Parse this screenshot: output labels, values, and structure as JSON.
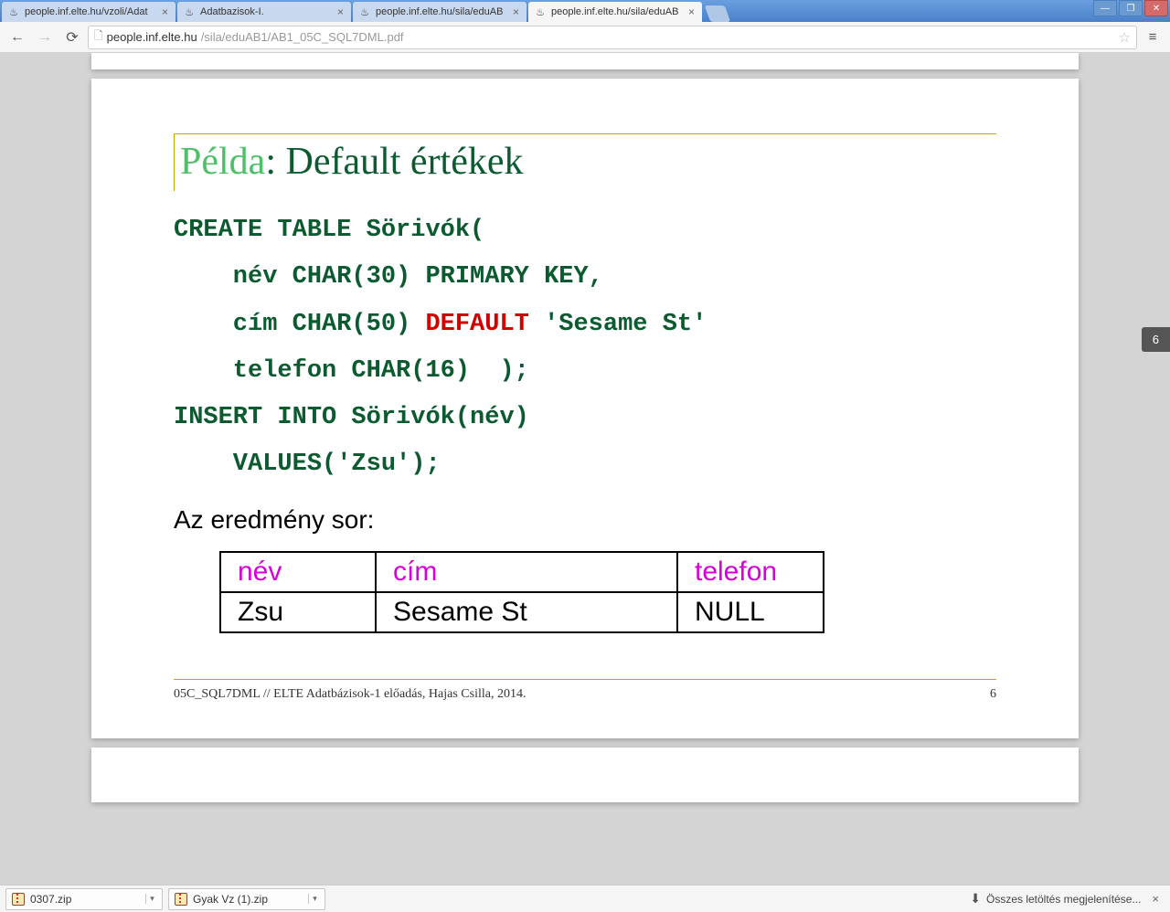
{
  "tabs": [
    {
      "title": "people.inf.elte.hu/vzoli/Adat",
      "active": false
    },
    {
      "title": "Adatbazisok-I.",
      "active": false
    },
    {
      "title": "people.inf.elte.hu/sila/eduAB",
      "active": false
    },
    {
      "title": "people.inf.elte.hu/sila/eduAB",
      "active": true
    }
  ],
  "url": {
    "host": "people.inf.elte.hu",
    "path": "/sila/eduAB1/AB1_05C_SQL7DML.pdf"
  },
  "page_bubble": "6",
  "slide": {
    "title_a": "Példa",
    "title_sep": ": ",
    "title_b": "Default értékek",
    "code": {
      "l1": "CREATE TABLE Sörivók(",
      "l2": "    név CHAR(30) PRIMARY KEY,",
      "l3a": "    cím CHAR(50) ",
      "l3b": "DEFAULT",
      "l3c": " 'Sesame St'",
      "l4": "    telefon CHAR(16)  );",
      "l5": "INSERT INTO Sörivók(név)",
      "l6": "    VALUES('Zsu');"
    },
    "result_label": "Az eredmény sor:",
    "table": {
      "headers": [
        "név",
        "cím",
        "telefon"
      ],
      "row": [
        "Zsu",
        "Sesame St",
        "NULL"
      ]
    },
    "footer_left": "05C_SQL7DML // ELTE Adatbázisok-1 előadás, Hajas Csilla, 2014.",
    "footer_right": "6"
  },
  "downloads": {
    "items": [
      {
        "name": "0307.zip"
      },
      {
        "name": "Gyak Vz (1).zip"
      }
    ],
    "show_all": "Összes letöltés megjelenítése..."
  }
}
